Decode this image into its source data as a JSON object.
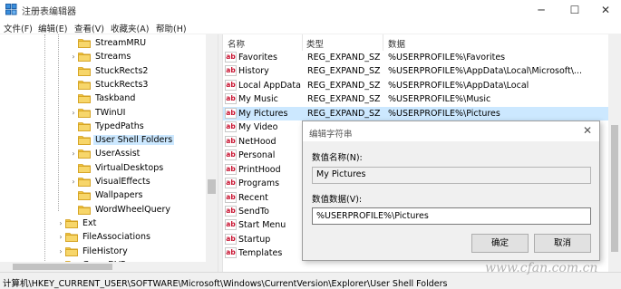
{
  "window": {
    "title": "注册表编辑器",
    "min_glyph": "─",
    "max_glyph": "☐",
    "close_glyph": "✕"
  },
  "menu": [
    "文件(F)",
    "编辑(E)",
    "查看(V)",
    "收藏夹(A)",
    "帮助(H)"
  ],
  "tree": {
    "items": [
      {
        "label": "StreamMRU",
        "expandable": false
      },
      {
        "label": "Streams",
        "expandable": true
      },
      {
        "label": "StuckRects2",
        "expandable": false
      },
      {
        "label": "StuckRects3",
        "expandable": false
      },
      {
        "label": "Taskband",
        "expandable": false
      },
      {
        "label": "TWinUI",
        "expandable": true
      },
      {
        "label": "TypedPaths",
        "expandable": false
      },
      {
        "label": "User Shell Folders",
        "expandable": false,
        "selected": true
      },
      {
        "label": "UserAssist",
        "expandable": true
      },
      {
        "label": "VirtualDesktops",
        "expandable": false
      },
      {
        "label": "VisualEffects",
        "expandable": true
      },
      {
        "label": "Wallpapers",
        "expandable": false
      },
      {
        "label": "WordWheelQuery",
        "expandable": false
      },
      {
        "label": "Ext",
        "expandable": true
      },
      {
        "label": "FileAssociations",
        "expandable": true
      },
      {
        "label": "FileHistory",
        "expandable": true
      },
      {
        "label": "GameDVR",
        "expandable": false
      }
    ]
  },
  "list": {
    "headers": {
      "name": "名称",
      "type": "类型",
      "data": "数据"
    },
    "rows": [
      {
        "name": "Favorites",
        "type": "REG_EXPAND_SZ",
        "data": "%USERPROFILE%\\Favorites"
      },
      {
        "name": "History",
        "type": "REG_EXPAND_SZ",
        "data": "%USERPROFILE%\\AppData\\Local\\Microsoft\\..."
      },
      {
        "name": "Local AppData",
        "type": "REG_EXPAND_SZ",
        "data": "%USERPROFILE%\\AppData\\Local"
      },
      {
        "name": "My Music",
        "type": "REG_EXPAND_SZ",
        "data": "%USERPROFILE%\\Music"
      },
      {
        "name": "My Pictures",
        "type": "REG_EXPAND_SZ",
        "data": "%USERPROFILE%\\Pictures",
        "selected": true
      },
      {
        "name": "My Video",
        "type": "",
        "data": ""
      },
      {
        "name": "NetHood",
        "type": "",
        "data": ""
      },
      {
        "name": "Personal",
        "type": "",
        "data": ""
      },
      {
        "name": "PrintHood",
        "type": "",
        "data": ""
      },
      {
        "name": "Programs",
        "type": "",
        "data": ""
      },
      {
        "name": "Recent",
        "type": "",
        "data": ""
      },
      {
        "name": "SendTo",
        "type": "",
        "data": ""
      },
      {
        "name": "Start Menu",
        "type": "",
        "data": ""
      },
      {
        "name": "Startup",
        "type": "",
        "data": ""
      },
      {
        "name": "Templates",
        "type": "",
        "data": ""
      }
    ],
    "value_icon": "ab"
  },
  "dialog": {
    "title": "编辑字符串",
    "close_glyph": "✕",
    "name_label": "数值名称(N):",
    "name_value": "My Pictures",
    "data_label": "数值数据(V):",
    "data_value": "%USERPROFILE%\\Pictures",
    "ok_label": "确定",
    "cancel_label": "取消"
  },
  "status": {
    "path": "计算机\\HKEY_CURRENT_USER\\SOFTWARE\\Microsoft\\Windows\\CurrentVersion\\Explorer\\User Shell Folders"
  },
  "watermark": "www.cfan.com.cn",
  "colors": {
    "selection": "#cce8ff",
    "folder": "#f0c43f",
    "accent": "#0078d7"
  }
}
